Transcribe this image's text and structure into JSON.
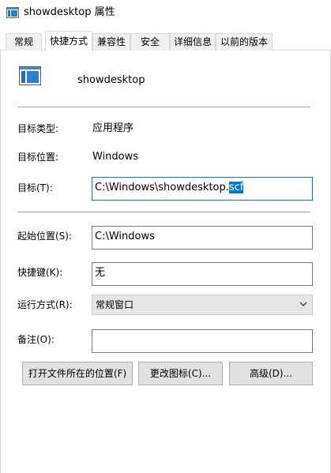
{
  "window": {
    "title": "showdesktop 属性",
    "icon": "shortcut-file-icon"
  },
  "tabs": [
    {
      "label": "常规"
    },
    {
      "label": "快捷方式",
      "active": true
    },
    {
      "label": "兼容性"
    },
    {
      "label": "安全"
    },
    {
      "label": "详细信息"
    },
    {
      "label": "以前的版本"
    }
  ],
  "shortcut": {
    "file_name": "showdesktop",
    "icon": "shortcut-file-icon",
    "target_type_label": "目标类型:",
    "target_type_value": "应用程序",
    "target_location_label": "目标位置:",
    "target_location_value": "Windows",
    "target_label": "目标(T):",
    "target_value_unselected": "C:\\Windows\\showdesktop.",
    "target_value_selected": "scf",
    "start_in_label": "起始位置(S):",
    "start_in_value": "C:\\Windows",
    "hotkey_label": "快捷键(K):",
    "hotkey_value": "无",
    "run_label": "运行方式(R):",
    "run_value": "常规窗口",
    "comment_label": "备注(O):",
    "comment_value": ""
  },
  "buttons": {
    "open_location": "打开文件所在的位置(F)",
    "change_icon": "更改图标(C)...",
    "advanced": "高级(D)..."
  },
  "colors": {
    "selection": "#0078d7",
    "focus_border": "#0078d7",
    "button_bg": "#e1e1e1",
    "dropdown_bg": "#e5e5e5"
  }
}
